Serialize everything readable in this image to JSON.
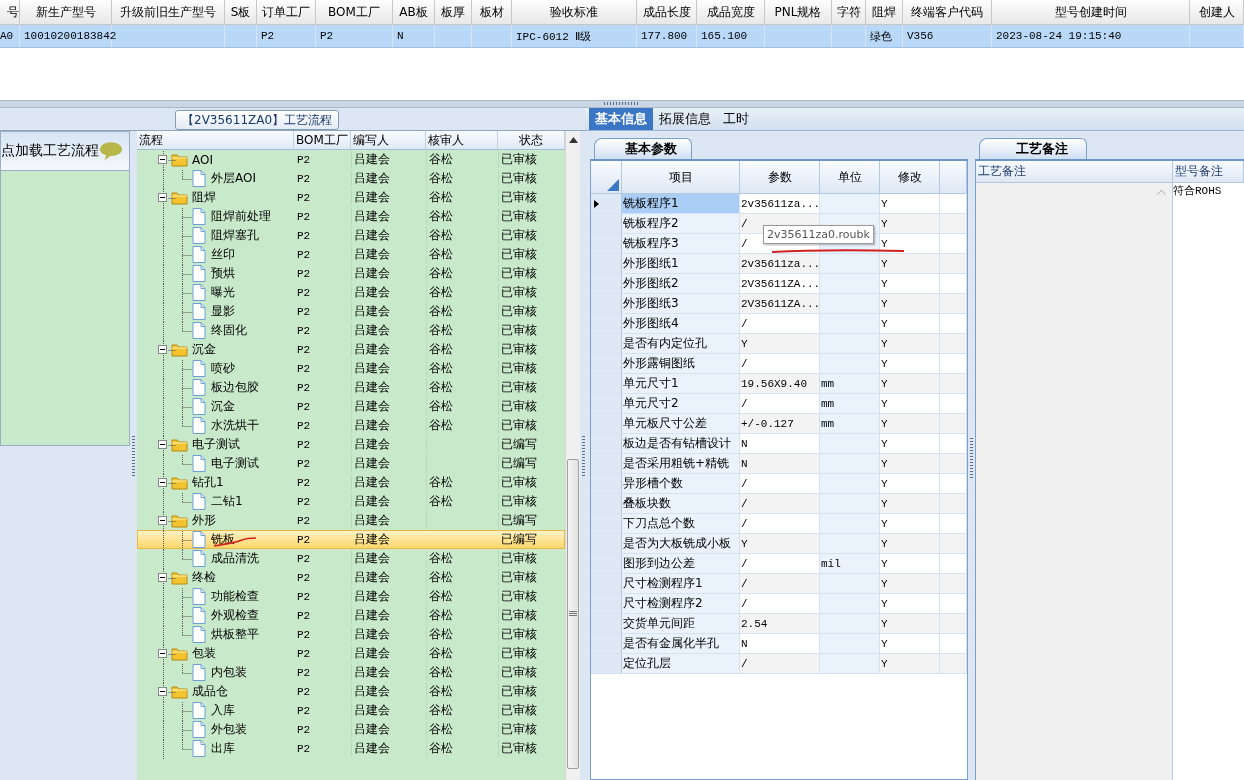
{
  "top_table": {
    "columns": [
      "号",
      "新生产型号",
      "升级前旧生产型号",
      "S板",
      "订单工厂",
      "BOM工厂",
      "AB板",
      "板厚",
      "板材",
      "验收标准",
      "成品长度",
      "成品宽度",
      "PNL规格",
      "字符",
      "阻焊",
      "终端客户代码",
      "型号创建时间",
      "创建人"
    ],
    "rows": [
      {
        "selected": true,
        "cells": [
          "A0",
          "10010200183842",
          null,
          null,
          "P2",
          "P2",
          "N",
          null,
          null,
          "IPC-6012 Ⅱ级",
          "177.800",
          "165.100",
          null,
          null,
          "绿色",
          "V356",
          "2023-08-24 19:15:40",
          null
        ]
      }
    ]
  },
  "process": {
    "title": "【2V35611ZA0】工艺流程",
    "loader_label": "点加载工艺流程",
    "tree": {
      "columns": [
        "流程",
        "BOM工厂",
        "编写人",
        "核审人",
        "状态"
      ],
      "items": [
        {
          "label": "AOI",
          "bom": "P2",
          "writer": "吕建会",
          "reviewer": "谷松",
          "status": "已审核",
          "expanded": true,
          "selected": false,
          "children": [
            {
              "label": "外层AOI",
              "bom": "P2",
              "writer": "吕建会",
              "reviewer": "谷松",
              "status": "已审核",
              "selected": false
            }
          ]
        },
        {
          "label": "阻焊",
          "bom": "P2",
          "writer": "吕建会",
          "reviewer": "谷松",
          "status": "已审核",
          "expanded": true,
          "selected": false,
          "children": [
            {
              "label": "阻焊前处理",
              "bom": "P2",
              "writer": "吕建会",
              "reviewer": "谷松",
              "status": "已审核",
              "selected": false
            },
            {
              "label": "阻焊塞孔",
              "bom": "P2",
              "writer": "吕建会",
              "reviewer": "谷松",
              "status": "已审核",
              "selected": false
            },
            {
              "label": "丝印",
              "bom": "P2",
              "writer": "吕建会",
              "reviewer": "谷松",
              "status": "已审核",
              "selected": false
            },
            {
              "label": "预烘",
              "bom": "P2",
              "writer": "吕建会",
              "reviewer": "谷松",
              "status": "已审核",
              "selected": false
            },
            {
              "label": "曝光",
              "bom": "P2",
              "writer": "吕建会",
              "reviewer": "谷松",
              "status": "已审核",
              "selected": false
            },
            {
              "label": "显影",
              "bom": "P2",
              "writer": "吕建会",
              "reviewer": "谷松",
              "status": "已审核",
              "selected": false
            },
            {
              "label": "终固化",
              "bom": "P2",
              "writer": "吕建会",
              "reviewer": "谷松",
              "status": "已审核",
              "selected": false
            }
          ]
        },
        {
          "label": "沉金",
          "bom": "P2",
          "writer": "吕建会",
          "reviewer": "谷松",
          "status": "已审核",
          "expanded": true,
          "selected": false,
          "children": [
            {
              "label": "喷砂",
              "bom": "P2",
              "writer": "吕建会",
              "reviewer": "谷松",
              "status": "已审核",
              "selected": false
            },
            {
              "label": "板边包胶",
              "bom": "P2",
              "writer": "吕建会",
              "reviewer": "谷松",
              "status": "已审核",
              "selected": false
            },
            {
              "label": "沉金",
              "bom": "P2",
              "writer": "吕建会",
              "reviewer": "谷松",
              "status": "已审核",
              "selected": false
            },
            {
              "label": "水洗烘干",
              "bom": "P2",
              "writer": "吕建会",
              "reviewer": "谷松",
              "status": "已审核",
              "selected": false
            }
          ]
        },
        {
          "label": "电子测试",
          "bom": "P2",
          "writer": "吕建会",
          "status": "已编写",
          "expanded": true,
          "selected": false,
          "children": [
            {
              "label": "电子测试",
              "bom": "P2",
              "writer": "吕建会",
              "status": "已编写",
              "selected": false
            }
          ]
        },
        {
          "label": "钻孔1",
          "bom": "P2",
          "writer": "吕建会",
          "reviewer": "谷松",
          "status": "已审核",
          "expanded": true,
          "selected": false,
          "children": [
            {
              "label": "二钻1",
              "bom": "P2",
              "writer": "吕建会",
              "reviewer": "谷松",
              "status": "已审核",
              "selected": false
            }
          ]
        },
        {
          "label": "外形",
          "bom": "P2",
          "writer": "吕建会",
          "status": "已编写",
          "expanded": true,
          "selected": false,
          "children": [
            {
              "label": "铣板",
              "bom": "P2",
              "writer": "吕建会",
              "status": "已编写",
              "selected": true
            },
            {
              "label": "成品清洗",
              "bom": "P2",
              "writer": "吕建会",
              "reviewer": "谷松",
              "status": "已审核",
              "selected": false
            }
          ]
        },
        {
          "label": "终检",
          "bom": "P2",
          "writer": "吕建会",
          "reviewer": "谷松",
          "status": "已审核",
          "expanded": true,
          "selected": false,
          "children": [
            {
              "label": "功能检查",
              "bom": "P2",
              "writer": "吕建会",
              "reviewer": "谷松",
              "status": "已审核",
              "selected": false
            },
            {
              "label": "外观检查",
              "bom": "P2",
              "writer": "吕建会",
              "reviewer": "谷松",
              "status": "已审核",
              "selected": false
            },
            {
              "label": "烘板整平",
              "bom": "P2",
              "writer": "吕建会",
              "reviewer": "谷松",
              "status": "已审核",
              "selected": false
            }
          ]
        },
        {
          "label": "包装",
          "bom": "P2",
          "writer": "吕建会",
          "reviewer": "谷松",
          "status": "已审核",
          "expanded": true,
          "selected": false,
          "children": [
            {
              "label": "内包装",
              "bom": "P2",
              "writer": "吕建会",
              "reviewer": "谷松",
              "status": "已审核",
              "selected": false
            }
          ]
        },
        {
          "label": "成品仓",
          "bom": "P2",
          "writer": "吕建会",
          "reviewer": "谷松",
          "status": "已审核",
          "expanded": true,
          "selected": false,
          "children": [
            {
              "label": "入库",
              "bom": "P2",
              "writer": "吕建会",
              "reviewer": "谷松",
              "status": "已审核",
              "selected": false
            },
            {
              "label": "外包装",
              "bom": "P2",
              "writer": "吕建会",
              "reviewer": "谷松",
              "status": "已审核",
              "selected": false
            },
            {
              "label": "出库",
              "bom": "P2",
              "writer": "吕建会",
              "reviewer": "谷松",
              "status": "已审核",
              "selected": false
            }
          ]
        }
      ]
    }
  },
  "info": {
    "tabs": [
      {
        "label": "基本信息",
        "selected": true
      },
      {
        "label": "拓展信息",
        "selected": false
      },
      {
        "label": "工时",
        "selected": false
      }
    ],
    "params": {
      "tab": "基本参数",
      "columns": [
        "项目",
        "参数",
        "单位",
        "修改"
      ],
      "rows": [
        {
          "item": "铣板程序1",
          "value": "2v35611za...",
          "modify": "Y",
          "selected": true
        },
        {
          "item": "铣板程序2",
          "value": "/",
          "modify": "Y",
          "selected": false
        },
        {
          "item": "铣板程序3",
          "value": "/",
          "modify": "Y",
          "selected": false
        },
        {
          "item": "外形图纸1",
          "value": "2v35611za...",
          "modify": "Y",
          "selected": false
        },
        {
          "item": "外形图纸2",
          "value": "2V35611ZA...",
          "modify": "Y",
          "selected": false
        },
        {
          "item": "外形图纸3",
          "value": "2V35611ZA...",
          "modify": "Y",
          "selected": false
        },
        {
          "item": "外形图纸4",
          "value": "/",
          "modify": "Y",
          "selected": false
        },
        {
          "item": "是否有内定位孔",
          "value": "Y",
          "modify": "Y",
          "selected": false
        },
        {
          "item": "外形露铜图纸",
          "value": "/",
          "modify": "Y",
          "selected": false
        },
        {
          "item": "单元尺寸1",
          "value": "19.56X9.40",
          "unit": "mm",
          "modify": "Y",
          "selected": false
        },
        {
          "item": "单元尺寸2",
          "value": "/",
          "unit": "mm",
          "modify": "Y",
          "selected": false
        },
        {
          "item": "单元板尺寸公差",
          "value": "+/-0.127",
          "unit": "mm",
          "modify": "Y",
          "selected": false
        },
        {
          "item": "板边是否有钻槽设计",
          "value": "N",
          "modify": "Y",
          "selected": false
        },
        {
          "item": "是否采用粗铣+精铣",
          "value": "N",
          "modify": "Y",
          "selected": false
        },
        {
          "item": "异形槽个数",
          "value": "/",
          "modify": "Y",
          "selected": false
        },
        {
          "item": "叠板块数",
          "value": "/",
          "modify": "Y",
          "selected": false
        },
        {
          "item": "下刀点总个数",
          "value": "/",
          "modify": "Y",
          "selected": false
        },
        {
          "item": "是否为大板铣成小板",
          "value": "Y",
          "modify": "Y",
          "selected": false
        },
        {
          "item": "图形到边公差",
          "value": "/",
          "unit": "mil",
          "modify": "Y",
          "selected": false
        },
        {
          "item": "尺寸检测程序1",
          "value": "/",
          "modify": "Y",
          "selected": false
        },
        {
          "item": "尺寸检测程序2",
          "value": "/",
          "modify": "Y",
          "selected": false
        },
        {
          "item": "交货单元间距",
          "value": "2.54",
          "modify": "Y",
          "selected": false
        },
        {
          "item": "是否有金属化半孔",
          "value": "N",
          "modify": "Y",
          "selected": false
        },
        {
          "item": "定位孔层",
          "value": "/",
          "modify": "Y",
          "selected": false
        }
      ]
    },
    "tooltip": "2v35611za0.roubk",
    "notes": {
      "tab": "工艺备注",
      "columns": [
        "工艺备注",
        "型号备注"
      ],
      "model_note": "符合ROHS"
    }
  }
}
